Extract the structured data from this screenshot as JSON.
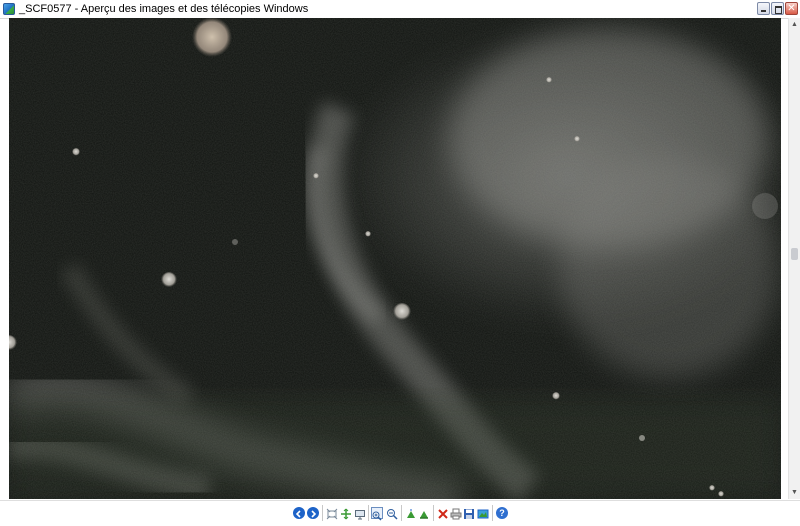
{
  "window": {
    "title": "_SCF0577 - Aperçu des images et des télécopies Windows",
    "icon": "image-viewer-app-icon",
    "controls": [
      "minimize-icon",
      "maximize-icon",
      "close-icon"
    ]
  },
  "viewer": {
    "image": "night photo with dust orbs and grey smoke wisps",
    "background_color": "#111410"
  },
  "toolbar": {
    "buttons": [
      "previous-image-icon",
      "next-image-icon",
      "best-fit-icon",
      "actual-size-icon",
      "slideshow-icon",
      "zoom-in-icon",
      "zoom-out-icon",
      "rotate-clockwise-icon",
      "rotate-counterclockwise-icon",
      "delete-icon",
      "print-icon",
      "save-icon",
      "open-with-icon",
      "help-icon"
    ],
    "colors": {
      "nav_blue": "#1d63c8",
      "rotate_green": "#3a9a34",
      "delete_red": "#d02818",
      "help_blue": "#2f6fd0"
    }
  }
}
